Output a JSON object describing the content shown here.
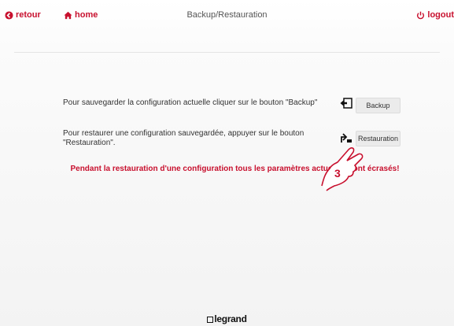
{
  "header": {
    "back_label": "retour",
    "home_label": "home",
    "title": "Backup/Restauration",
    "logout_label": "logout",
    "accent_color": "#c8102e"
  },
  "backup_row": {
    "description": "Pour sauvegarder la configuration actuelle cliquer sur le bouton \"Backup\"",
    "button_label": "Backup"
  },
  "restore_row": {
    "description": "Pour restaurer une configuration sauvegardée, appuyer sur le bouton \"Restauration\".",
    "button_label": "Restauration"
  },
  "warning": "Pendant la restauration d'une configuration tous les paramètres actuels seront écrasés!",
  "annotation": {
    "step_number": "3"
  },
  "footer": {
    "brand": "legrand"
  }
}
